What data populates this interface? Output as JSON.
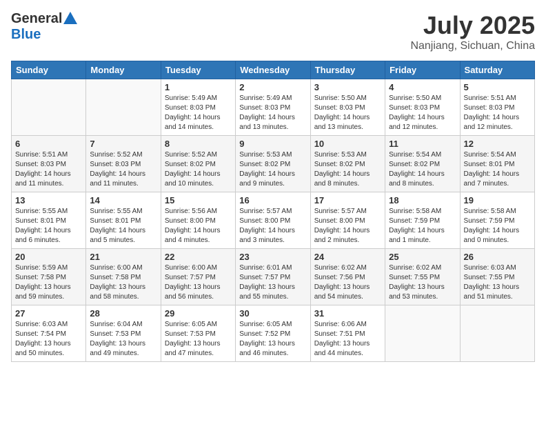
{
  "header": {
    "logo_general": "General",
    "logo_blue": "Blue",
    "month": "July 2025",
    "location": "Nanjiang, Sichuan, China"
  },
  "weekdays": [
    "Sunday",
    "Monday",
    "Tuesday",
    "Wednesday",
    "Thursday",
    "Friday",
    "Saturday"
  ],
  "weeks": [
    [
      {
        "day": "",
        "info": ""
      },
      {
        "day": "",
        "info": ""
      },
      {
        "day": "1",
        "info": "Sunrise: 5:49 AM\nSunset: 8:03 PM\nDaylight: 14 hours\nand 14 minutes."
      },
      {
        "day": "2",
        "info": "Sunrise: 5:49 AM\nSunset: 8:03 PM\nDaylight: 14 hours\nand 13 minutes."
      },
      {
        "day": "3",
        "info": "Sunrise: 5:50 AM\nSunset: 8:03 PM\nDaylight: 14 hours\nand 13 minutes."
      },
      {
        "day": "4",
        "info": "Sunrise: 5:50 AM\nSunset: 8:03 PM\nDaylight: 14 hours\nand 12 minutes."
      },
      {
        "day": "5",
        "info": "Sunrise: 5:51 AM\nSunset: 8:03 PM\nDaylight: 14 hours\nand 12 minutes."
      }
    ],
    [
      {
        "day": "6",
        "info": "Sunrise: 5:51 AM\nSunset: 8:03 PM\nDaylight: 14 hours\nand 11 minutes."
      },
      {
        "day": "7",
        "info": "Sunrise: 5:52 AM\nSunset: 8:03 PM\nDaylight: 14 hours\nand 11 minutes."
      },
      {
        "day": "8",
        "info": "Sunrise: 5:52 AM\nSunset: 8:02 PM\nDaylight: 14 hours\nand 10 minutes."
      },
      {
        "day": "9",
        "info": "Sunrise: 5:53 AM\nSunset: 8:02 PM\nDaylight: 14 hours\nand 9 minutes."
      },
      {
        "day": "10",
        "info": "Sunrise: 5:53 AM\nSunset: 8:02 PM\nDaylight: 14 hours\nand 8 minutes."
      },
      {
        "day": "11",
        "info": "Sunrise: 5:54 AM\nSunset: 8:02 PM\nDaylight: 14 hours\nand 8 minutes."
      },
      {
        "day": "12",
        "info": "Sunrise: 5:54 AM\nSunset: 8:01 PM\nDaylight: 14 hours\nand 7 minutes."
      }
    ],
    [
      {
        "day": "13",
        "info": "Sunrise: 5:55 AM\nSunset: 8:01 PM\nDaylight: 14 hours\nand 6 minutes."
      },
      {
        "day": "14",
        "info": "Sunrise: 5:55 AM\nSunset: 8:01 PM\nDaylight: 14 hours\nand 5 minutes."
      },
      {
        "day": "15",
        "info": "Sunrise: 5:56 AM\nSunset: 8:00 PM\nDaylight: 14 hours\nand 4 minutes."
      },
      {
        "day": "16",
        "info": "Sunrise: 5:57 AM\nSunset: 8:00 PM\nDaylight: 14 hours\nand 3 minutes."
      },
      {
        "day": "17",
        "info": "Sunrise: 5:57 AM\nSunset: 8:00 PM\nDaylight: 14 hours\nand 2 minutes."
      },
      {
        "day": "18",
        "info": "Sunrise: 5:58 AM\nSunset: 7:59 PM\nDaylight: 14 hours\nand 1 minute."
      },
      {
        "day": "19",
        "info": "Sunrise: 5:58 AM\nSunset: 7:59 PM\nDaylight: 14 hours\nand 0 minutes."
      }
    ],
    [
      {
        "day": "20",
        "info": "Sunrise: 5:59 AM\nSunset: 7:58 PM\nDaylight: 13 hours\nand 59 minutes."
      },
      {
        "day": "21",
        "info": "Sunrise: 6:00 AM\nSunset: 7:58 PM\nDaylight: 13 hours\nand 58 minutes."
      },
      {
        "day": "22",
        "info": "Sunrise: 6:00 AM\nSunset: 7:57 PM\nDaylight: 13 hours\nand 56 minutes."
      },
      {
        "day": "23",
        "info": "Sunrise: 6:01 AM\nSunset: 7:57 PM\nDaylight: 13 hours\nand 55 minutes."
      },
      {
        "day": "24",
        "info": "Sunrise: 6:02 AM\nSunset: 7:56 PM\nDaylight: 13 hours\nand 54 minutes."
      },
      {
        "day": "25",
        "info": "Sunrise: 6:02 AM\nSunset: 7:55 PM\nDaylight: 13 hours\nand 53 minutes."
      },
      {
        "day": "26",
        "info": "Sunrise: 6:03 AM\nSunset: 7:55 PM\nDaylight: 13 hours\nand 51 minutes."
      }
    ],
    [
      {
        "day": "27",
        "info": "Sunrise: 6:03 AM\nSunset: 7:54 PM\nDaylight: 13 hours\nand 50 minutes."
      },
      {
        "day": "28",
        "info": "Sunrise: 6:04 AM\nSunset: 7:53 PM\nDaylight: 13 hours\nand 49 minutes."
      },
      {
        "day": "29",
        "info": "Sunrise: 6:05 AM\nSunset: 7:53 PM\nDaylight: 13 hours\nand 47 minutes."
      },
      {
        "day": "30",
        "info": "Sunrise: 6:05 AM\nSunset: 7:52 PM\nDaylight: 13 hours\nand 46 minutes."
      },
      {
        "day": "31",
        "info": "Sunrise: 6:06 AM\nSunset: 7:51 PM\nDaylight: 13 hours\nand 44 minutes."
      },
      {
        "day": "",
        "info": ""
      },
      {
        "day": "",
        "info": ""
      }
    ]
  ]
}
